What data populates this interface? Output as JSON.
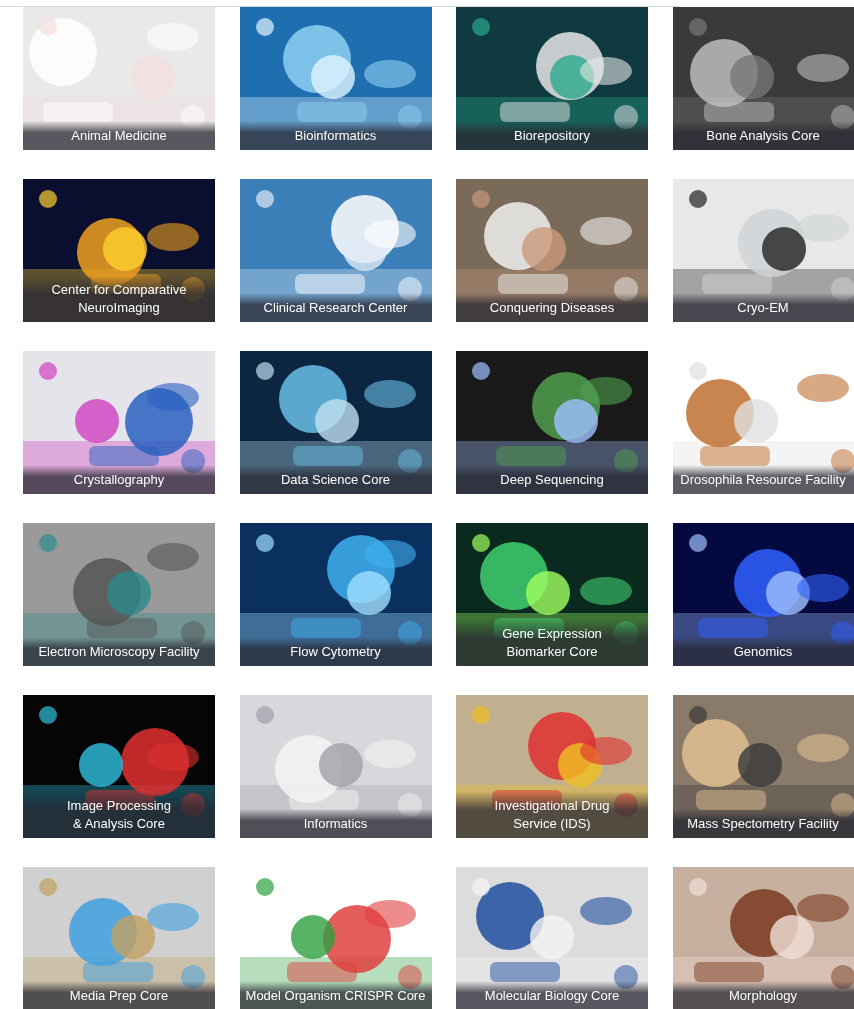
{
  "tiles": [
    {
      "label": "Animal Medicine"
    },
    {
      "label": "Bioinformatics"
    },
    {
      "label": "Biorepository"
    },
    {
      "label": "Bone Analysis Core"
    },
    {
      "label": "Center for Comparative\nNeuroImaging"
    },
    {
      "label": "Clinical Research Center"
    },
    {
      "label": "Conquering Diseases"
    },
    {
      "label": "Cryo-EM"
    },
    {
      "label": "Crystallography"
    },
    {
      "label": "Data Science Core"
    },
    {
      "label": "Deep Sequencing"
    },
    {
      "label": "Drosophila Resource Facility"
    },
    {
      "label": "Electron Microscopy Facility"
    },
    {
      "label": "Flow Cytometry"
    },
    {
      "label": "Gene Expression\nBiomarker Core"
    },
    {
      "label": "Genomics"
    },
    {
      "label": "Image Processing\n& Analysis Core"
    },
    {
      "label": "Informatics"
    },
    {
      "label": "Investigational Drug\nService (IDS)"
    },
    {
      "label": "Mass Spectometry Facility"
    },
    {
      "label": "Media Prep Core"
    },
    {
      "label": "Model Organism CRISPR Core"
    },
    {
      "label": "Molecular Biology Core"
    },
    {
      "label": "Morphology"
    }
  ]
}
